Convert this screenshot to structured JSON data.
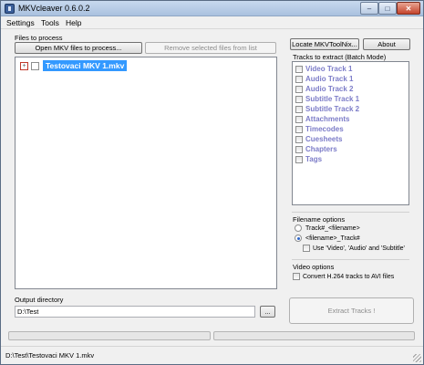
{
  "window": {
    "title": "MKVcleaver 0.6.0.2",
    "minimize": "–",
    "maximize": "□",
    "close": "✕"
  },
  "menu": {
    "items": [
      "Settings",
      "Tools",
      "Help"
    ]
  },
  "files": {
    "group_label": "Files to process",
    "open_button": "Open MKV files to process...",
    "remove_button": "Remove selected files from list",
    "tree_toggle": "+",
    "items": [
      "Testovaci MKV 1.mkv"
    ]
  },
  "right": {
    "locate_button": "Locate MKVToolNix...",
    "about_button": "About"
  },
  "tracks": {
    "group_label": "Tracks to extract (Batch Mode)",
    "items": [
      "Video Track 1",
      "Audio Track 1",
      "Audio Track 2",
      "Subtitle Track 1",
      "Subtitle Track 2",
      "Attachments",
      "Timecodes",
      "Cuesheets",
      "Chapters",
      "Tags"
    ]
  },
  "filename_options": {
    "group_label": "Filename options",
    "option1": "Track#_<filename>",
    "option2": "<filename>_Track#",
    "selected": "<filename>_Track#",
    "checkbox_label": "Use 'Video', 'Audio' and 'Subtitle'"
  },
  "video_options": {
    "group_label": "Video options",
    "checkbox_label": "Convert H.264 tracks to AVI files"
  },
  "output": {
    "group_label": "Output directory",
    "path": "D:\\Test",
    "browse_button": "..."
  },
  "extract_button": "Extract Tracks !",
  "status": {
    "text": "D:\\Test\\Testovaci MKV 1.mkv"
  }
}
